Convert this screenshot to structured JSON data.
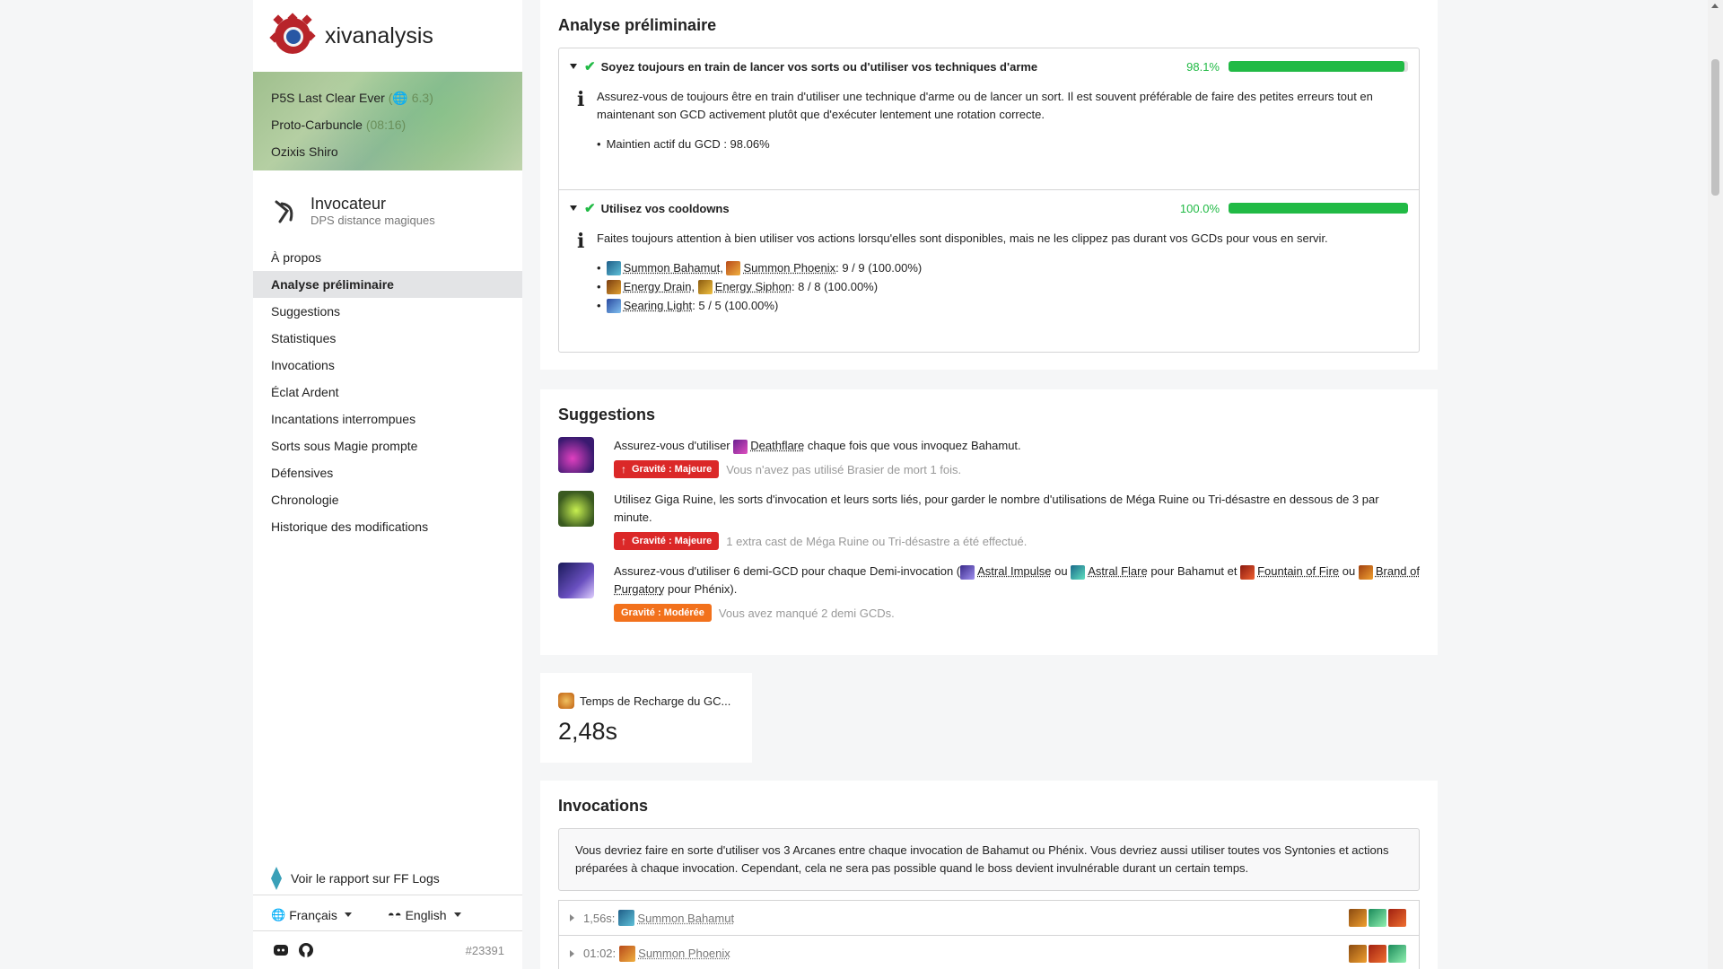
{
  "app": {
    "name": "xivanalysis"
  },
  "report": {
    "fight": "P5S Last Clear Ever",
    "patch": "6.3",
    "server": "Proto-Carbuncle",
    "duration": "(08:16)",
    "player": "Ozixis Shiro"
  },
  "job": {
    "name": "Invocateur",
    "role": "DPS distance magiques"
  },
  "nav": {
    "items": [
      "À propos",
      "Analyse préliminaire",
      "Suggestions",
      "Statistiques",
      "Invocations",
      "Éclat Ardent",
      "Incantations interrompues",
      "Sorts sous Magie prompte",
      "Défensives",
      "Chronologie",
      "Historique des modifications"
    ],
    "active": "Analyse préliminaire"
  },
  "footer": {
    "fflogs": "Voir le rapport sur FF Logs",
    "lang1": "Français",
    "lang2": "English",
    "build": "#23391"
  },
  "checklist": {
    "title": "Analyse préliminaire",
    "items": [
      {
        "title": "Soyez toujours en train de lancer vos sorts ou d'utiliser vos techniques d'arme",
        "percent": "98.1%",
        "fill": 0.981,
        "text": "Assurez-vous de toujours être en train d'utiliser une technique d'arme ou de lancer un sort. Il est souvent préférable de faire des petites erreurs tout en maintenant son GCD activement plutôt que d'exécuter lentement une rotation correcte.",
        "bullet": "Maintien actif du GCD : 98.06%"
      },
      {
        "title": "Utilisez vos cooldowns",
        "percent": "100.0%",
        "fill": 1.0,
        "text": "Faites toujours attention à bien utiliser vos actions lorsqu'elles sont disponibles, mais ne les clippez pas durant vos GCDs pour vous en servir.",
        "b1a": "Summon Bahamut",
        "b1b": "Summon Phoenix",
        "b1v": ": 9 / 9 (100.00%)",
        "b2a": "Energy Drain",
        "b2b": "Energy Siphon",
        "b2v": ": 8 / 8 (100.00%)",
        "b3a": "Searing Light",
        "b3v": ": 5 / 5 (100.00%)"
      }
    ]
  },
  "suggestions": {
    "title": "Suggestions",
    "s1": {
      "pre": "Assurez-vous d'utiliser",
      "action": "Deathflare",
      "post": "chaque fois que vous invoquez Bahamut.",
      "severity": "Gravité : Majeure",
      "why": "Vous n'avez pas utilisé Brasier de mort 1 fois."
    },
    "s2": {
      "text": "Utilisez Giga Ruine, les sorts d'invocation et leurs sorts liés, pour garder le nombre d'utilisations de Méga Ruine ou Tri-désastre en dessous de 3 par minute.",
      "severity": "Gravité : Majeure",
      "why": "1 extra cast de Méga Ruine ou Tri-désastre a été effectué."
    },
    "s3": {
      "pre": "Assurez-vous d'utiliser 6 demi-GCD pour chaque Demi-invocation (",
      "a1": "Astral Impulse",
      "or1": "ou",
      "a2": "Astral Flare",
      "mid": "pour Bahamut et",
      "a3": "Fountain of Fire",
      "or2": "ou",
      "a4": "Brand of Purgatory",
      "post": "pour Phénix).",
      "severity": "Gravité : Modérée",
      "why": "Vous avez manqué 2 demi GCDs."
    }
  },
  "stat": {
    "label": "Temps de Recharge du GC...",
    "value": "2,48s"
  },
  "invocations": {
    "title": "Invocations",
    "note": "Vous devriez faire en sorte d'utiliser vos 3 Arcanes entre chaque invocation de Bahamut ou Phénix. Vous devriez aussi utiliser toutes vos Syntonies et actions préparées à chaque invocation. Cependant, cela ne sera pas possible quand le boss devient invulnérable durant un certain temps.",
    "rows": [
      {
        "time": "1,56s:",
        "summon": "Summon Bahamut"
      },
      {
        "time": "01:02:",
        "summon": "Summon Phoenix"
      }
    ]
  },
  "colors": {
    "success": "#21ba45",
    "major": "#db2828",
    "moderate": "#f2711c",
    "bahamut": "#2b7fa8",
    "phoenix": "#e0802a",
    "energy": "#c8a020",
    "searing": "#4a7fd0"
  }
}
